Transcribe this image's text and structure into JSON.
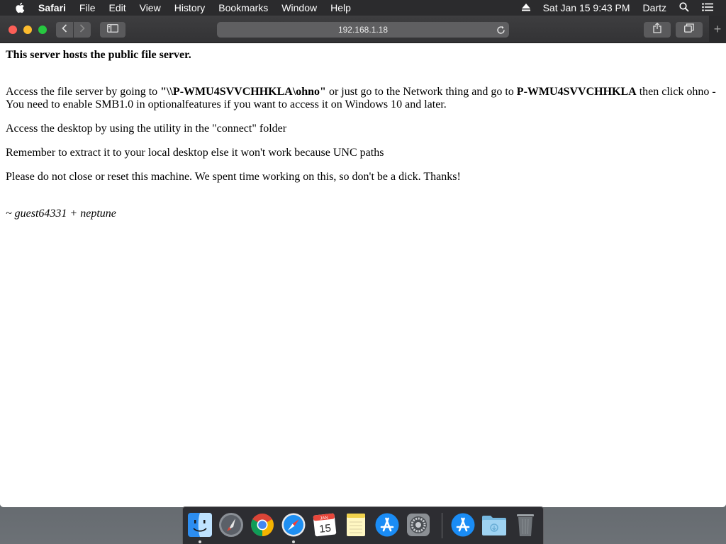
{
  "menubar": {
    "apple_icon": "apple-icon",
    "items": [
      "Safari",
      "File",
      "Edit",
      "View",
      "History",
      "Bookmarks",
      "Window",
      "Help"
    ],
    "eject_icon": "eject-icon",
    "clock": "Sat Jan 15  9:43 PM",
    "user": "Dartz",
    "search_icon": "spotlight-icon",
    "list_icon": "notification-center-icon"
  },
  "toolbar": {
    "address": "192.168.1.18",
    "reload_icon": "reload-icon",
    "back_icon": "chevron-left-icon",
    "forward_icon": "chevron-right-icon",
    "sidebar_icon": "sidebar-icon",
    "share_icon": "share-icon",
    "tabs_icon": "tabs-overview-icon",
    "new_tab_label": "+"
  },
  "page": {
    "heading": "This server hosts the public file server.",
    "p1": {
      "t1": "Access the file server by going to ",
      "b1": "\"\\\\P-WMU4SVVCHHKLA\\ohno\"",
      "t2": " or just go to the Network thing and go to ",
      "b2": "P-WMU4SVVCHHKLA",
      "t3": " then click ohno - You need to enable SMB1.0 in optionalfeatures if you want to access it on Windows 10 and later."
    },
    "p2": "Access the desktop by using the utility in the \"connect\" folder",
    "p3": "Remember to extract it to your local desktop else it won't work because UNC paths",
    "p4": "Please do not close or reset this machine. We spent time working on this, so don't be a dick. Thanks!",
    "signature": "~ guest64331 + neptune"
  },
  "dock": {
    "items": [
      {
        "name": "finder-icon",
        "running": true
      },
      {
        "name": "launchpad-icon",
        "running": false
      },
      {
        "name": "chrome-icon",
        "running": false
      },
      {
        "name": "safari-icon",
        "running": true
      },
      {
        "name": "calendar-icon",
        "running": false,
        "month": "JAN",
        "day": "15"
      },
      {
        "name": "notes-icon",
        "running": false
      },
      {
        "name": "app-store-icon",
        "running": false
      },
      {
        "name": "system-preferences-icon",
        "running": false
      },
      {
        "name": "downloads-stack-icon",
        "running": false
      },
      {
        "name": "folder-icon",
        "running": false
      },
      {
        "name": "trash-icon",
        "running": false
      }
    ]
  }
}
